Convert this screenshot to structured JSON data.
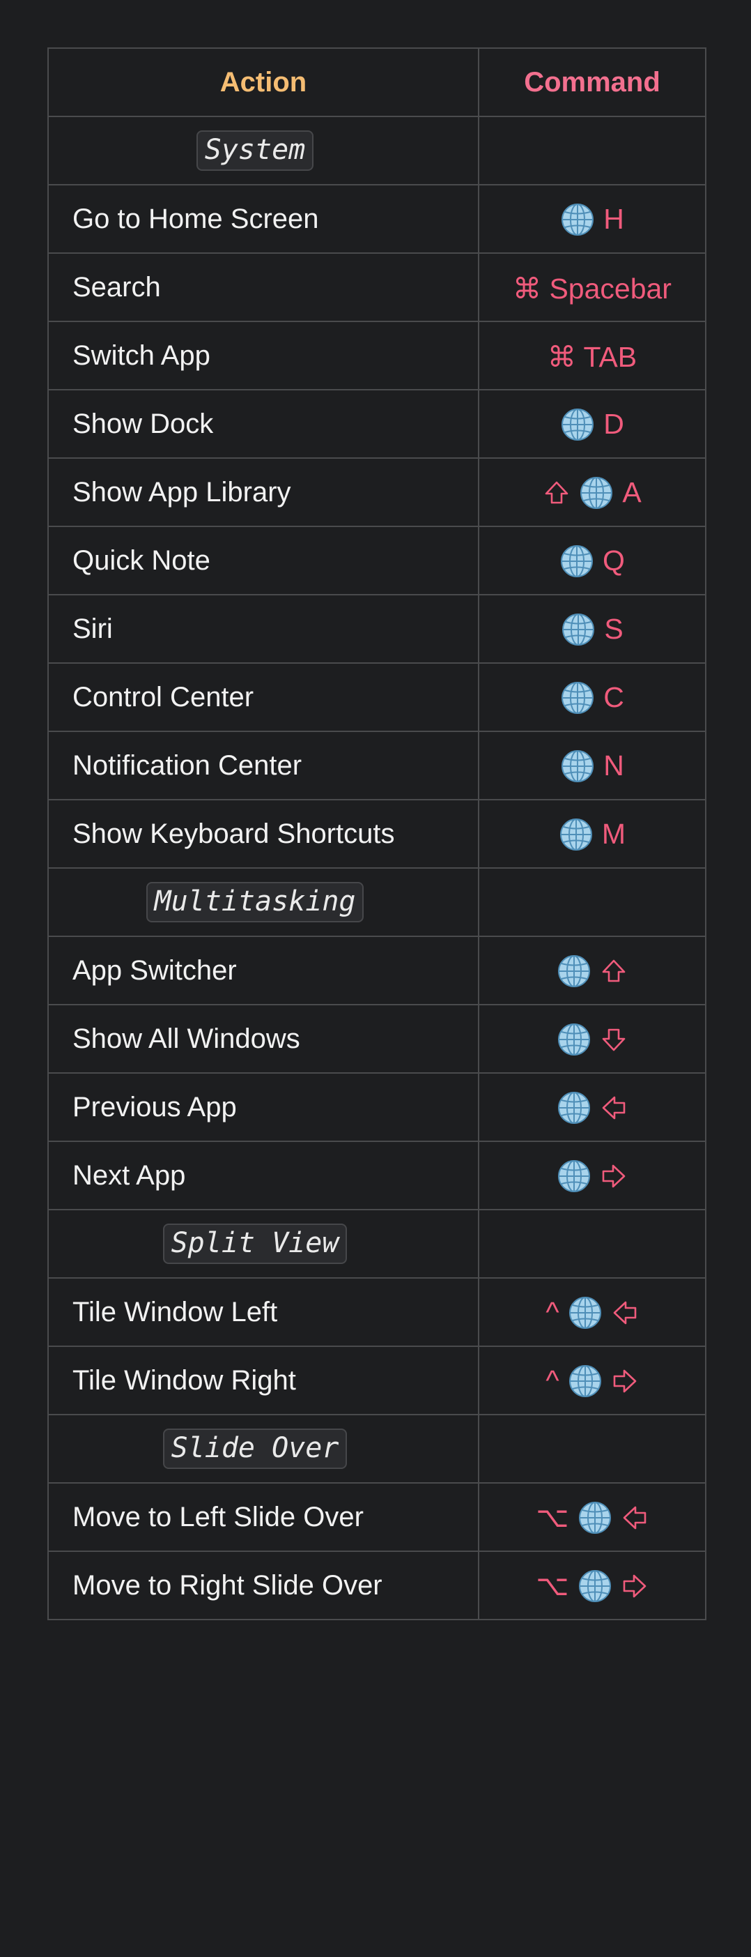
{
  "table": {
    "headers": {
      "action": "Action",
      "command": "Command"
    },
    "rows": [
      {
        "type": "section",
        "label": "System"
      },
      {
        "type": "shortcut",
        "action": "Go to Home Screen",
        "keys": [
          {
            "kind": "globe",
            "name": "globe-icon"
          },
          {
            "kind": "text",
            "text": "H"
          }
        ]
      },
      {
        "type": "shortcut",
        "action": "Search",
        "keys": [
          {
            "kind": "text",
            "text": "⌘ Spacebar"
          }
        ]
      },
      {
        "type": "shortcut",
        "action": "Switch App",
        "keys": [
          {
            "kind": "text",
            "text": "⌘ TAB"
          }
        ]
      },
      {
        "type": "shortcut",
        "action": "Show Dock",
        "keys": [
          {
            "kind": "globe",
            "name": "globe-icon"
          },
          {
            "kind": "text",
            "text": "D"
          }
        ]
      },
      {
        "type": "shortcut",
        "action": "Show App Library",
        "keys": [
          {
            "kind": "arrow",
            "dir": "up",
            "name": "shift-icon"
          },
          {
            "kind": "globe",
            "name": "globe-icon"
          },
          {
            "kind": "text",
            "text": "A"
          }
        ]
      },
      {
        "type": "shortcut",
        "action": "Quick Note",
        "keys": [
          {
            "kind": "globe",
            "name": "globe-icon"
          },
          {
            "kind": "text",
            "text": "Q"
          }
        ]
      },
      {
        "type": "shortcut",
        "action": "Siri",
        "keys": [
          {
            "kind": "globe",
            "name": "globe-icon"
          },
          {
            "kind": "text",
            "text": "S"
          }
        ]
      },
      {
        "type": "shortcut",
        "action": "Control Center",
        "keys": [
          {
            "kind": "globe",
            "name": "globe-icon"
          },
          {
            "kind": "text",
            "text": "C"
          }
        ]
      },
      {
        "type": "shortcut",
        "action": "Notification Center",
        "keys": [
          {
            "kind": "globe",
            "name": "globe-icon"
          },
          {
            "kind": "text",
            "text": "N"
          }
        ]
      },
      {
        "type": "shortcut",
        "action": "Show Keyboard Shortcuts",
        "keys": [
          {
            "kind": "globe",
            "name": "globe-icon"
          },
          {
            "kind": "text",
            "text": "M"
          }
        ]
      },
      {
        "type": "section",
        "label": "Multitasking"
      },
      {
        "type": "shortcut",
        "action": "App Switcher",
        "keys": [
          {
            "kind": "globe",
            "name": "globe-icon"
          },
          {
            "kind": "arrow",
            "dir": "up",
            "name": "arrow-up-icon"
          }
        ]
      },
      {
        "type": "shortcut",
        "action": "Show All Windows",
        "keys": [
          {
            "kind": "globe",
            "name": "globe-icon"
          },
          {
            "kind": "arrow",
            "dir": "down",
            "name": "arrow-down-icon"
          }
        ]
      },
      {
        "type": "shortcut",
        "action": "Previous App",
        "keys": [
          {
            "kind": "globe",
            "name": "globe-icon"
          },
          {
            "kind": "arrow",
            "dir": "left",
            "name": "arrow-left-icon"
          }
        ]
      },
      {
        "type": "shortcut",
        "action": "Next App",
        "keys": [
          {
            "kind": "globe",
            "name": "globe-icon"
          },
          {
            "kind": "arrow",
            "dir": "right",
            "name": "arrow-right-icon"
          }
        ]
      },
      {
        "type": "section",
        "label": "Split View"
      },
      {
        "type": "shortcut",
        "action": "Tile Window Left",
        "keys": [
          {
            "kind": "text",
            "text": "^"
          },
          {
            "kind": "globe",
            "name": "globe-icon"
          },
          {
            "kind": "arrow",
            "dir": "left",
            "name": "arrow-left-icon"
          }
        ]
      },
      {
        "type": "shortcut",
        "action": "Tile Window Right",
        "keys": [
          {
            "kind": "text",
            "text": "^"
          },
          {
            "kind": "globe",
            "name": "globe-icon"
          },
          {
            "kind": "arrow",
            "dir": "right",
            "name": "arrow-right-icon"
          }
        ]
      },
      {
        "type": "section",
        "label": "Slide Over"
      },
      {
        "type": "shortcut",
        "action": "Move to Left Slide Over",
        "keys": [
          {
            "kind": "text",
            "text": "⌥"
          },
          {
            "kind": "globe",
            "name": "globe-icon"
          },
          {
            "kind": "arrow",
            "dir": "left",
            "name": "arrow-left-icon"
          }
        ]
      },
      {
        "type": "shortcut",
        "action": "Move to Right Slide Over",
        "keys": [
          {
            "kind": "text",
            "text": "⌥"
          },
          {
            "kind": "globe",
            "name": "globe-icon"
          },
          {
            "kind": "arrow",
            "dir": "right",
            "name": "arrow-right-icon"
          }
        ]
      }
    ]
  },
  "colors": {
    "background": "#1d1e20",
    "border": "#4a4b4d",
    "action_header": "#f5bd73",
    "command_header": "#f3708f",
    "command_text": "#f05b7c",
    "globe_fill": "#a9d4ec",
    "globe_lines": "#4f8fb8"
  }
}
